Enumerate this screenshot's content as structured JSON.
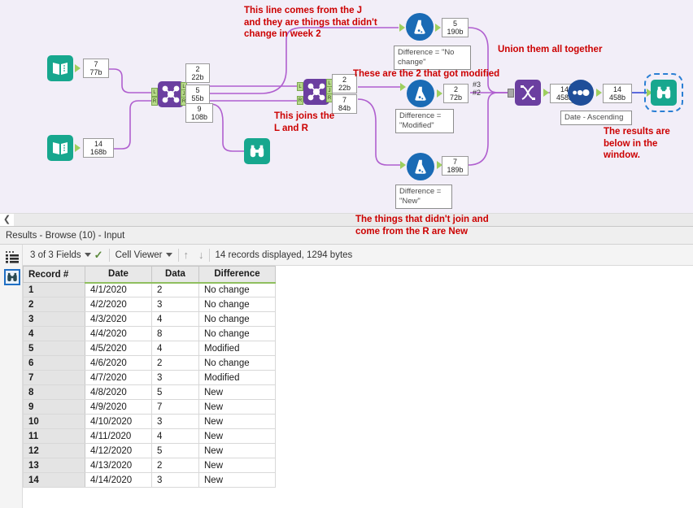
{
  "canvas": {
    "background_color": "#f2eef8",
    "tools": [
      {
        "id": "input1",
        "name": "input-data-tool-1",
        "type": "input",
        "count": "7",
        "bytes": "77b"
      },
      {
        "id": "input2",
        "name": "input-data-tool-2",
        "type": "input",
        "count": "14",
        "bytes": "168b"
      },
      {
        "id": "join1",
        "name": "join-tool-1",
        "type": "join",
        "outputs": [
          {
            "label": "L",
            "count": "2",
            "bytes": "22b"
          },
          {
            "label": "J",
            "count": "5",
            "bytes": "55b"
          },
          {
            "label": "R",
            "count": "9",
            "bytes": "108b"
          }
        ]
      },
      {
        "id": "browse_mid",
        "name": "browse-tool-middle",
        "type": "browse"
      },
      {
        "id": "join2",
        "name": "join-tool-2",
        "type": "join",
        "outputs": [
          {
            "label": "L",
            "count": "2",
            "bytes": "22b"
          },
          {
            "label": "R",
            "count": "7",
            "bytes": "84b"
          }
        ]
      },
      {
        "id": "formula_top",
        "name": "formula-tool-no-change",
        "type": "formula",
        "count": "5",
        "bytes": "190b",
        "config": "Difference = \"No change\""
      },
      {
        "id": "formula_mid",
        "name": "formula-tool-modified",
        "type": "formula",
        "count": "2",
        "bytes": "72b",
        "config": "Difference = \"Modified\""
      },
      {
        "id": "formula_bot",
        "name": "formula-tool-new",
        "type": "formula",
        "count": "7",
        "bytes": "189b",
        "config": "Difference = \"New\""
      },
      {
        "id": "union",
        "name": "union-tool",
        "type": "union",
        "count": "14",
        "bytes": "458b"
      },
      {
        "id": "sort",
        "name": "sort-tool",
        "type": "sort",
        "count": "14",
        "bytes": "458b",
        "config": "Date - Ascending"
      },
      {
        "id": "browse_end",
        "name": "browse-tool-output",
        "type": "browse",
        "selected": true
      }
    ],
    "union_inputs_label": "#3\n#2",
    "comments": [
      {
        "name": "comment-line-from-j",
        "text": "This line comes from the J\nand they are things that didn't\nchange in week 2"
      },
      {
        "name": "comment-these-are-modified",
        "text": "These are the 2 that got modified"
      },
      {
        "name": "comment-union-them",
        "text": "Union them all together"
      },
      {
        "name": "comment-joins-l-and-r",
        "text": "This joins the\nL and R"
      },
      {
        "name": "comment-results-below",
        "text": "The results are\nbelow in the\nwindow."
      },
      {
        "name": "comment-didnt-join-new",
        "text": "The things that didn't join and\ncome from the R are New"
      }
    ],
    "comment_color": "#cc0000"
  },
  "results": {
    "title": "Results - Browse (10) - Input",
    "toolbar": {
      "fields_label": "3 of 3 Fields",
      "viewer_label": "Cell Viewer",
      "status": "14 records displayed, 1294 bytes"
    },
    "columns": [
      "Record #",
      "Date",
      "Data",
      "Difference"
    ],
    "rows": [
      {
        "record": "1",
        "date": "4/1/2020",
        "data": "2",
        "difference": "No change"
      },
      {
        "record": "2",
        "date": "4/2/2020",
        "data": "3",
        "difference": "No change"
      },
      {
        "record": "3",
        "date": "4/3/2020",
        "data": "4",
        "difference": "No change"
      },
      {
        "record": "4",
        "date": "4/4/2020",
        "data": "8",
        "difference": "No change"
      },
      {
        "record": "5",
        "date": "4/5/2020",
        "data": "4",
        "difference": "Modified"
      },
      {
        "record": "6",
        "date": "4/6/2020",
        "data": "2",
        "difference": "No change"
      },
      {
        "record": "7",
        "date": "4/7/2020",
        "data": "3",
        "difference": "Modified"
      },
      {
        "record": "8",
        "date": "4/8/2020",
        "data": "5",
        "difference": "New"
      },
      {
        "record": "9",
        "date": "4/9/2020",
        "data": "7",
        "difference": "New"
      },
      {
        "record": "10",
        "date": "4/10/2020",
        "data": "3",
        "difference": "New"
      },
      {
        "record": "11",
        "date": "4/11/2020",
        "data": "4",
        "difference": "New"
      },
      {
        "record": "12",
        "date": "4/12/2020",
        "data": "5",
        "difference": "New"
      },
      {
        "record": "13",
        "date": "4/13/2020",
        "data": "2",
        "difference": "New"
      },
      {
        "record": "14",
        "date": "4/14/2020",
        "data": "3",
        "difference": "New"
      }
    ]
  }
}
